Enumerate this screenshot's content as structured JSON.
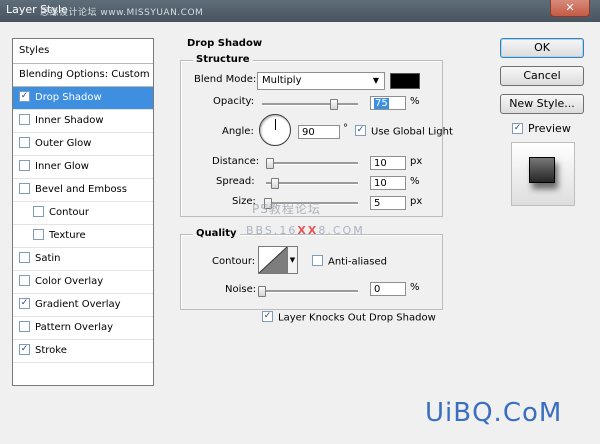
{
  "window": {
    "title": "Layer Style",
    "watermark": "思缘设计论坛 www.MISSYUAN.COM",
    "close_label": "✕"
  },
  "styles_panel": {
    "header": "Styles",
    "blending_options": "Blending Options: Custom",
    "items": [
      {
        "label": "Drop Shadow",
        "checked": true,
        "selected": true
      },
      {
        "label": "Inner Shadow",
        "checked": false
      },
      {
        "label": "Outer Glow",
        "checked": false
      },
      {
        "label": "Inner Glow",
        "checked": false
      },
      {
        "label": "Bevel and Emboss",
        "checked": false
      },
      {
        "label": "Contour",
        "checked": false,
        "indent": true
      },
      {
        "label": "Texture",
        "checked": false,
        "indent": true
      },
      {
        "label": "Satin",
        "checked": false
      },
      {
        "label": "Color Overlay",
        "checked": false
      },
      {
        "label": "Gradient Overlay",
        "checked": true
      },
      {
        "label": "Pattern Overlay",
        "checked": false
      },
      {
        "label": "Stroke",
        "checked": true
      }
    ]
  },
  "drop_shadow": {
    "title": "Drop Shadow",
    "structure": {
      "title": "Structure",
      "blend_mode_label": "Blend Mode:",
      "blend_mode_value": "Multiply",
      "shadow_color": "#000000",
      "opacity_label": "Opacity:",
      "opacity_value": "75",
      "opacity_unit": "%",
      "opacity_level": 0.75,
      "angle_label": "Angle:",
      "angle_value": "90",
      "angle_unit": "°",
      "use_global_light_label": "Use Global Light",
      "use_global_light": true,
      "distance_label": "Distance:",
      "distance_value": "10",
      "distance_unit": "px",
      "distance_level": 0.04,
      "spread_label": "Spread:",
      "spread_value": "10",
      "spread_unit": "%",
      "spread_level": 0.1,
      "size_label": "Size:",
      "size_value": "5",
      "size_unit": "px",
      "size_level": 0.02
    },
    "quality": {
      "title": "Quality",
      "contour_label": "Contour:",
      "anti_aliased_label": "Anti-aliased",
      "anti_aliased": false,
      "noise_label": "Noise:",
      "noise_value": "0",
      "noise_unit": "%",
      "noise_level": 0
    },
    "knocks_out_label": "Layer Knocks Out Drop Shadow",
    "knocks_out": true
  },
  "buttons": {
    "ok": "OK",
    "cancel": "Cancel",
    "new_style": "New Style...",
    "preview_label": "Preview",
    "preview": true
  },
  "watermarks": {
    "mid_line1": "PS教程论坛",
    "mid_line2_a": "BBS.16",
    "mid_line2_b": "XX",
    "mid_line2_c": "8.COM",
    "corner": "UiBQ.CoM"
  }
}
